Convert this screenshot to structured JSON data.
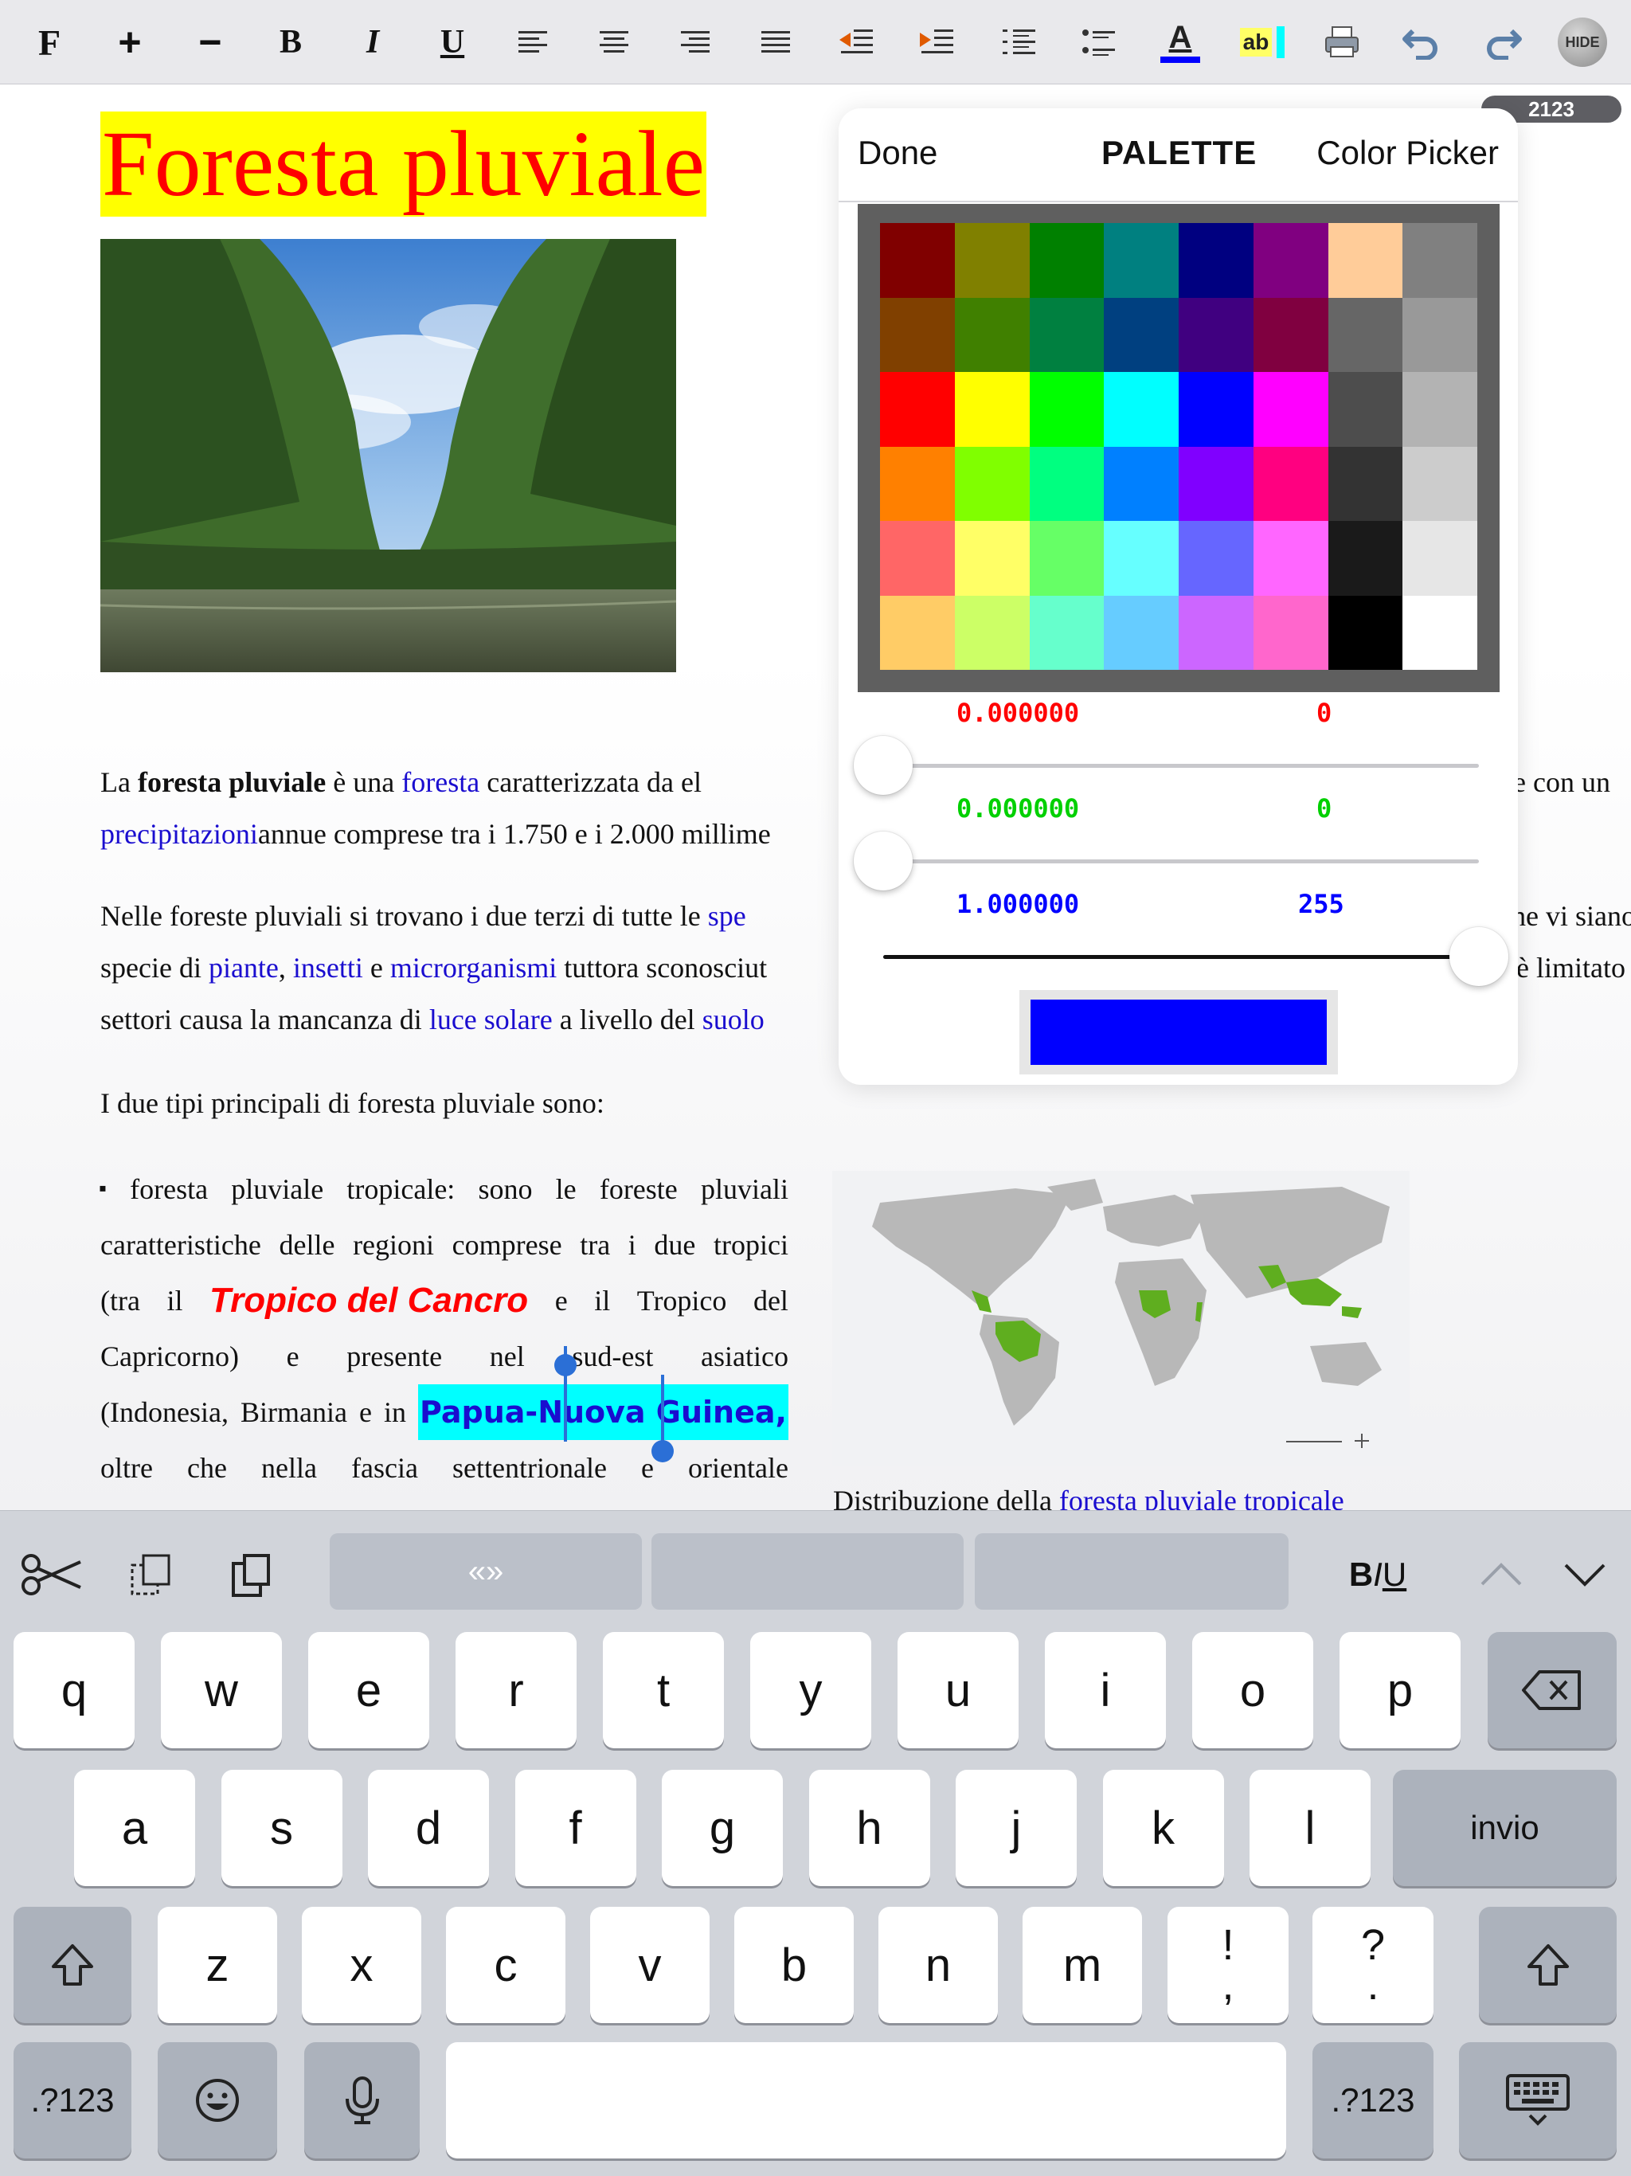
{
  "toolbar": {
    "font": "F",
    "increase": "+",
    "decrease": "−",
    "bold": "B",
    "italic": "I",
    "underline": "U",
    "text_color": "A",
    "highlight": "ab",
    "hide": "HIDE"
  },
  "document": {
    "page_counter": "2123",
    "title": "Foresta pluviale",
    "p1": {
      "l1_a": "La ",
      "l1_b": "foresta pluviale",
      "l1_c": " è una ",
      "l1_link": "foresta",
      "l1_d": " caratterizzata da el",
      "l1_tail": "e con un",
      "l2_link": "precipitazioni",
      "l2_rest": "annue comprese tra i 1.750 e i 2.000 millime"
    },
    "p2": {
      "l1_a": "Nelle foreste pluviali si trovano i due terzi di tutte le ",
      "l1_link": "spe",
      "l1_tail": "che vi siano",
      "l2_a": "specie di ",
      "l2_link1": "piante",
      "l2_b": ", ",
      "l2_link2": "insetti",
      "l2_c": " e ",
      "l2_link3": "microrganismi",
      "l2_d": " tuttora sconosciut",
      "l2_tail": "è limitato",
      "l3_a": "settori causa la mancanza di ",
      "l3_link1": "luce solare",
      "l3_b": " a livello del ",
      "l3_link2": "suolo"
    },
    "p3": "I due tipi principali di foresta pluviale sono:",
    "bullet": {
      "marker": "▪",
      "l1": [
        "foresta",
        "pluviale",
        "tropicale:",
        "sono",
        "le",
        "foreste",
        "pluviali"
      ],
      "l2": [
        "caratteristiche",
        "delle",
        "regioni",
        "comprese",
        "tra",
        "i",
        "due",
        "tropici"
      ],
      "l3_a": "(tra",
      "l3_b": "il",
      "l3_tropico": "Tropico del Cancro",
      "l3_c": "e",
      "l3_d": "il",
      "l3_e": "Tropico",
      "l3_f": "del",
      "l4": [
        "Capricorno)",
        "e",
        "presente",
        "nel",
        "sud-est",
        "asiatico"
      ],
      "l5_a": "(Indonesia,",
      "l5_b": "Birmania",
      "l5_c": "e",
      "l5_d": "in",
      "l5_papua": "Papua-Nuova Guinea,",
      "l6": [
        "oltre",
        "che",
        "nella",
        "fascia",
        "settentrionale",
        "e",
        "orientale"
      ]
    },
    "map_caption_a": "Distribuzione della ",
    "map_caption_link": "foresta pluviale tropicale"
  },
  "popover": {
    "done": "Done",
    "palette": "PALETTE",
    "picker": "Color Picker",
    "swatches": [
      "#800000",
      "#808000",
      "#008000",
      "#008080",
      "#000080",
      "#800080",
      "#ffcc99",
      "#808080",
      "#804000",
      "#408000",
      "#008040",
      "#004080",
      "#400080",
      "#800040",
      "#666666",
      "#999999",
      "#ff0000",
      "#ffff00",
      "#00ff00",
      "#00ffff",
      "#0000ff",
      "#ff00ff",
      "#4d4d4d",
      "#b3b3b3",
      "#ff8000",
      "#80ff00",
      "#00ff80",
      "#0080ff",
      "#8000ff",
      "#ff0080",
      "#333333",
      "#cccccc",
      "#ff6666",
      "#ffff66",
      "#66ff66",
      "#66ffff",
      "#6666ff",
      "#ff66ff",
      "#1a1a1a",
      "#e6e6e6",
      "#ffcc66",
      "#ccff66",
      "#66ffcc",
      "#66ccff",
      "#cc66ff",
      "#ff66cc",
      "#000000",
      "#ffffff"
    ],
    "red": {
      "float": "0.000000",
      "int": "0",
      "level": 0,
      "color": "#ff0000"
    },
    "green": {
      "float": "0.000000",
      "int": "0",
      "level": 0,
      "color": "#00d000"
    },
    "blue": {
      "float": "1.000000",
      "int": "255",
      "level": 1,
      "color": "#0000ff"
    },
    "preview_color": "#0000ff"
  },
  "keyboard": {
    "suggestion": "«»",
    "biu": {
      "b": "B",
      "i": "I",
      "u": "U"
    },
    "row1": [
      "q",
      "w",
      "e",
      "r",
      "t",
      "y",
      "u",
      "i",
      "o",
      "p"
    ],
    "row2": [
      "a",
      "s",
      "d",
      "f",
      "g",
      "h",
      "j",
      "k",
      "l"
    ],
    "enter": "invio",
    "row3": [
      "z",
      "x",
      "c",
      "v",
      "b",
      "n",
      "m"
    ],
    "excl_top": "!",
    "excl_bottom": ",",
    "quest_top": "?",
    "quest_bottom": ".",
    "numbers": ".?123"
  }
}
